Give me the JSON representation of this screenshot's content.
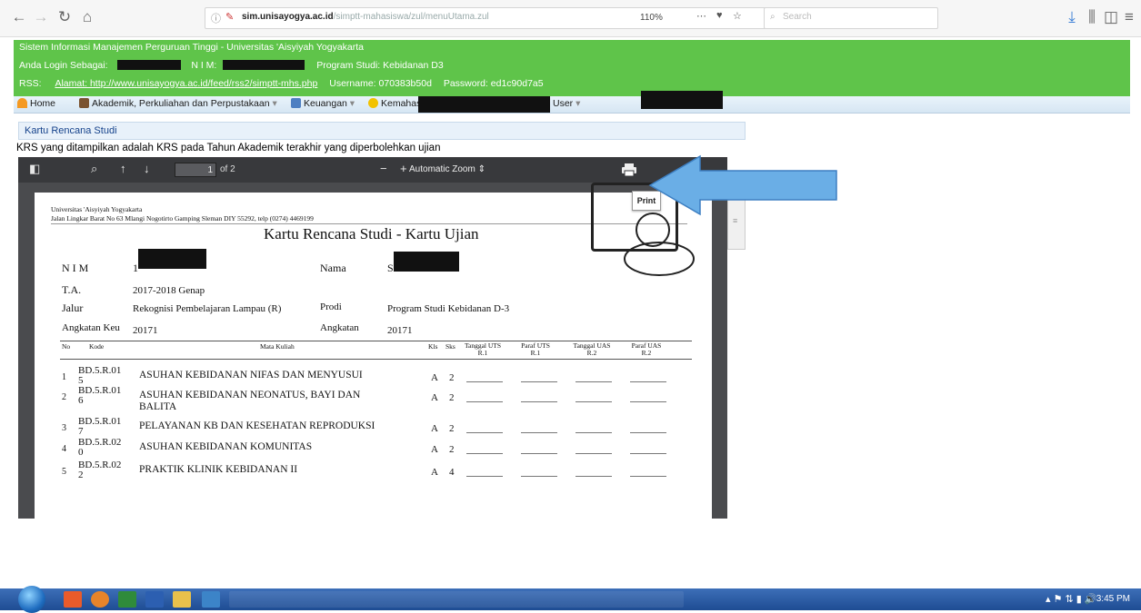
{
  "browser": {
    "url_domain": "sim.unisayogya.ac.id",
    "url_path": "/simptt-mahasiswa/zul/menuUtama.zul",
    "zoom": "110%",
    "search_placeholder": "Search"
  },
  "header": {
    "line1": "Sistem Informasi Manajemen Perguruan Tinggi - Universitas 'Aisyiyah Yogyakarta",
    "login_label": "Anda Login Sebagai:",
    "nim_label": "N I M:",
    "prodi_label": "Program Studi: Kebidanan D3",
    "rss_label": "RSS:",
    "rss_address": "Alamat: http://www.unisayogya.ac.id/feed/rss2/simptt-mhs.php",
    "rss_username": "Username: 070383b50d",
    "rss_password": "Password: ed1c90d7a5"
  },
  "menu": {
    "home": "Home",
    "akademik": "Akademik, Perkuliahan dan Perpustakaan",
    "keuangan": "Keuangan",
    "kemahasiswaan": "Kemahas",
    "user": "User"
  },
  "panel": {
    "title": "Kartu Rencana Studi",
    "note": "KRS yang ditampilkan adalah KRS pada Tahun Akademik terakhir yang diperbolehkan ujian"
  },
  "pdf_toolbar": {
    "page_value": "1",
    "page_total": "of 2",
    "zoom_label": "Automatic Zoom",
    "print_tooltip": "Print"
  },
  "document": {
    "university": "Universitas 'Aisyiyah Yogyakarta",
    "address": "Jalan Lingkar Barat No 63 Mlangi Nogotirto Gamping Sleman DIY 55292, telp (0274) 4469199",
    "title": "Kartu Rencana Studi - Kartu Ujian",
    "nim_label": "N I M",
    "nim_prefix": "1",
    "nama_label": "Nama",
    "nama_prefix": "S",
    "ta_label": "T.A.",
    "ta_value": "2017-2018 Genap",
    "jalur_label": "Jalur",
    "jalur_value": "Rekognisi Pembelajaran Lampau (R)",
    "prodi_label": "Prodi",
    "prodi_value": "Program Studi Kebidanan D-3",
    "angkeu_label": "Angkatan Keu",
    "angkeu_value": "20171",
    "angkatan_label": "Angkatan",
    "angkatan_value": "20171",
    "columns": {
      "no": "No",
      "kode": "Kode",
      "mk": "Mata Kuliah",
      "kls": "Kls",
      "sks": "Sks",
      "tgl_uts": "Tanggal UTS R.1",
      "paraf_uts": "Paraf UTS R.1",
      "tgl_uas": "Tanggal UAS R.2",
      "paraf_uas": "Paraf UAS R.2"
    },
    "rows": [
      {
        "no": "1",
        "kode1": "BD.5.R.01",
        "kode2": "5",
        "mk1": "ASUHAN KEBIDANAN NIFAS DAN MENYUSUI",
        "mk2": "",
        "kls": "A",
        "sks": "2"
      },
      {
        "no": "2",
        "kode1": "BD.5.R.01",
        "kode2": "6",
        "mk1": "ASUHAN KEBIDANAN NEONATUS, BAYI DAN",
        "mk2": "BALITA",
        "kls": "A",
        "sks": "2"
      },
      {
        "no": "3",
        "kode1": "BD.5.R.01",
        "kode2": "7",
        "mk1": "PELAYANAN KB DAN KESEHATAN REPRODUKSI",
        "mk2": "",
        "kls": "A",
        "sks": "2"
      },
      {
        "no": "4",
        "kode1": "BD.5.R.02",
        "kode2": "0",
        "mk1": "ASUHAN KEBIDANAN KOMUNITAS",
        "mk2": "",
        "kls": "A",
        "sks": "2"
      },
      {
        "no": "5",
        "kode1": "BD.5.R.02",
        "kode2": "2",
        "mk1": "PRAKTIK KLINIK KEBIDANAN II",
        "mk2": "",
        "kls": "A",
        "sks": "4"
      }
    ]
  },
  "taskbar": {
    "clock": "3:45 PM"
  },
  "colors": {
    "header_green": "#5fc44a",
    "arrow_blue": "#6aaee6",
    "pdf_toolbar": "#38393c"
  }
}
